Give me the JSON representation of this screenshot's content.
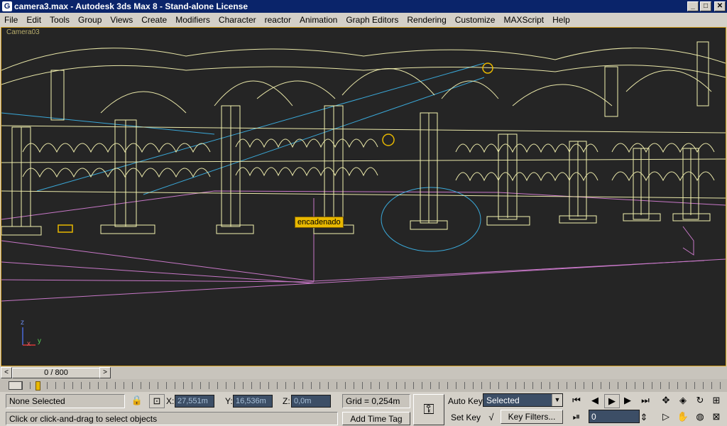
{
  "window": {
    "title": "camera3.max - Autodesk 3ds Max 8  - Stand-alone License",
    "app_icon": "3ds-max-icon",
    "minimize": "_",
    "maximize": "□",
    "close": "✕"
  },
  "menu": [
    "File",
    "Edit",
    "Tools",
    "Group",
    "Views",
    "Create",
    "Modifiers",
    "Character",
    "reactor",
    "Animation",
    "Graph Editors",
    "Rendering",
    "Customize",
    "MAXScript",
    "Help"
  ],
  "viewport": {
    "label": "Camera03",
    "object_tag": "encadenado",
    "axis": {
      "z": "z",
      "x": "x",
      "y": "y"
    },
    "colors": {
      "background": "#252525",
      "wire": "#f4f2b0",
      "border": "#d8a322",
      "magenta": "#c878c8",
      "cyan": "#3aa8d8"
    }
  },
  "timeslider": {
    "value": "0 / 800",
    "prev": "<",
    "next": ">"
  },
  "status": {
    "selection": "None Selected",
    "prompt": "Click or click-and-drag to select objects",
    "x_label": "X:",
    "x_value": "27,551m",
    "y_label": "Y:",
    "y_value": "16,536m",
    "z_label": "Z:",
    "z_value": "0,0m",
    "grid": "Grid = 0,254m",
    "add_time_tag": "Add Time Tag",
    "auto_key": "Auto Key",
    "set_key": "Set Key",
    "selected_dropdown": "Selected",
    "key_filters": "Key Filters...",
    "frame_value": "0"
  }
}
